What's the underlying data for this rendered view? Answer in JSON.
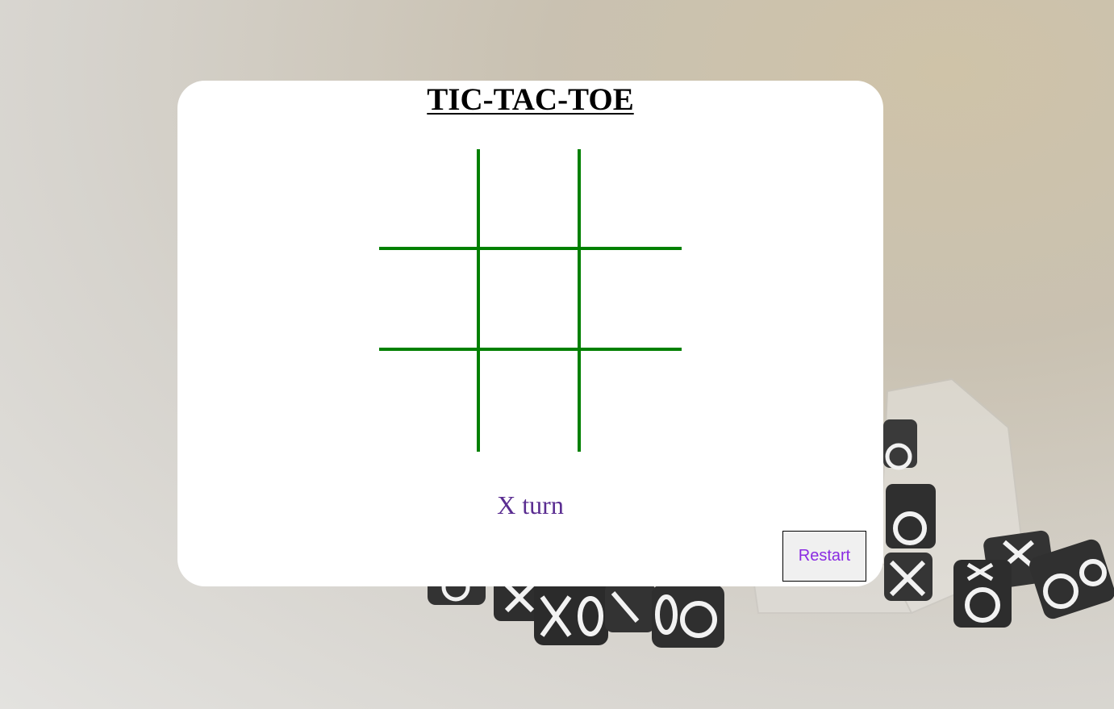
{
  "app": {
    "title": "TIC-TAC-TOE"
  },
  "board": {
    "cells": [
      "",
      "",
      "",
      "",
      "",
      "",
      "",
      "",
      ""
    ],
    "grid_color": "#008000"
  },
  "status": {
    "text": "X turn",
    "color": "#5a2d91"
  },
  "controls": {
    "restart_label": "Restart"
  },
  "background": {
    "description_icon": "dice-icon"
  }
}
